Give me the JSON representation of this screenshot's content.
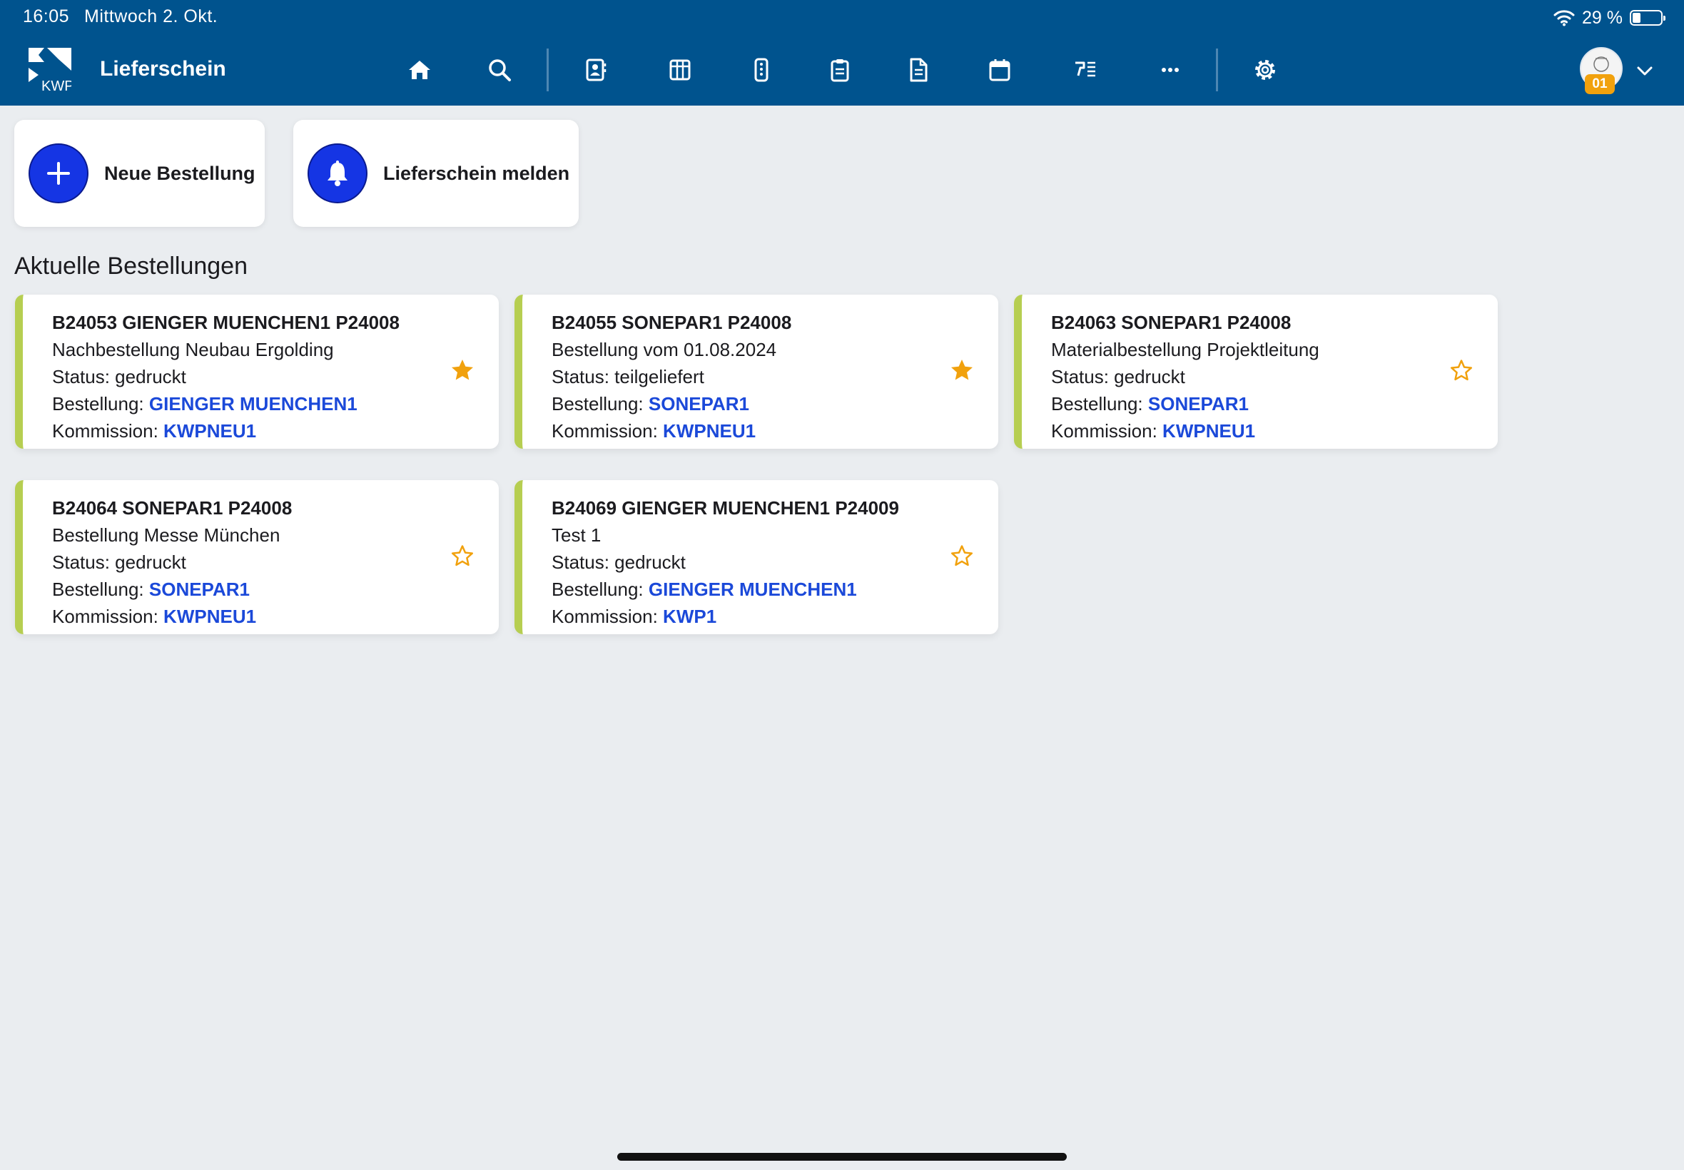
{
  "status_bar": {
    "time": "16:05",
    "date": "Mittwoch 2. Okt.",
    "battery": "29 %",
    "battery_level": 0.29
  },
  "header": {
    "title": "Lieferschein",
    "nav_icons": [
      "home-icon",
      "search-icon",
      "contacts-icon",
      "grid-icon",
      "remote-icon",
      "clipboard-icon",
      "document-icon",
      "calendar-icon",
      "tools-list-icon",
      "more-icon",
      "settings-icon"
    ],
    "avatar_badge": "01",
    "colors": {
      "bar": "#00538e"
    }
  },
  "actions": {
    "new_order": "Neue Bestellung",
    "report_delivery": "Lieferschein melden"
  },
  "section_title": "Aktuelle Bestellungen",
  "labels": {
    "status": "Status: ",
    "order": "Bestellung: ",
    "commission": "Kommission: "
  },
  "orders": [
    {
      "title": "B24053 GIENGER MUENCHEN1 P24008",
      "description": "Nachbestellung Neubau Ergolding",
      "status": "gedruckt",
      "supplier": "GIENGER MUENCHEN1",
      "commission": "KWPNEU1",
      "favorite": true
    },
    {
      "title": "B24055 SONEPAR1 P24008",
      "description": "Bestellung vom 01.08.2024",
      "status": "teilgeliefert",
      "supplier": "SONEPAR1",
      "commission": "KWPNEU1",
      "favorite": true
    },
    {
      "title": "B24063 SONEPAR1 P24008",
      "description": "Materialbestellung Projektleitung",
      "status": "gedruckt",
      "supplier": "SONEPAR1",
      "commission": "KWPNEU1",
      "favorite": false
    },
    {
      "title": "B24064 SONEPAR1 P24008",
      "description": "Bestellung Messe München",
      "status": "gedruckt",
      "supplier": "SONEPAR1",
      "commission": "KWPNEU1",
      "favorite": false
    },
    {
      "title": "B24069 GIENGER MUENCHEN1 P24009",
      "description": "Test 1",
      "status": "gedruckt",
      "supplier": "GIENGER MUENCHEN1",
      "commission": "KWP1",
      "favorite": false
    }
  ],
  "colors": {
    "accent_blue": "#1535e4",
    "link_blue": "#1b49d9",
    "card_stripe": "#b6ce51",
    "star": "#f1a10d"
  }
}
